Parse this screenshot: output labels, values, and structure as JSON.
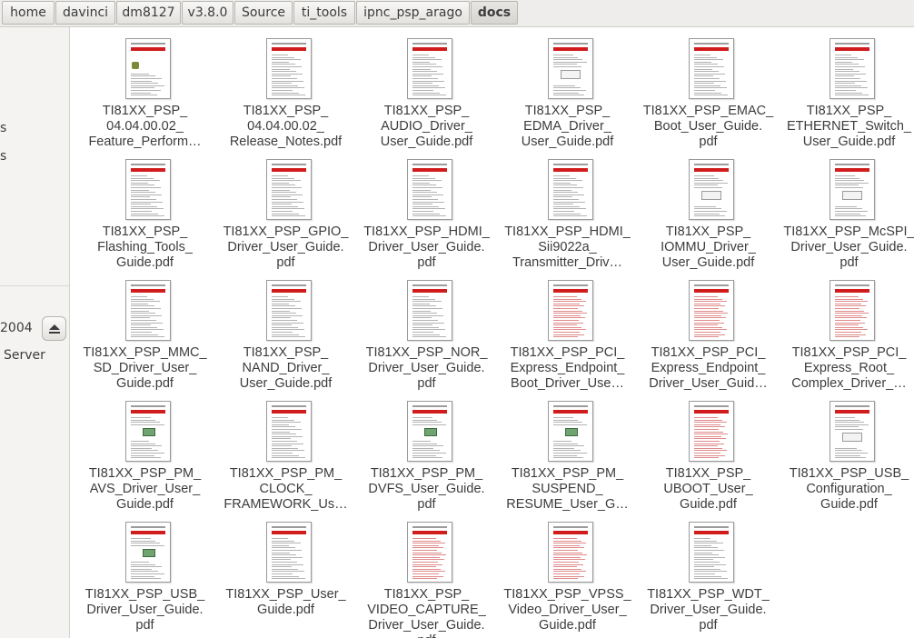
{
  "breadcrumb": [
    "home",
    "davinci",
    "dm8127",
    "v3.8.0",
    "Source",
    "ti_tools",
    "ipnc_psp_arago",
    "docs"
  ],
  "sidebar": {
    "items": [
      "s",
      "s",
      "2004",
      "Server"
    ]
  },
  "files": [
    {
      "lines": [
        "TI81XX_PSP_",
        "04.04.00.02_",
        "Feature_Perform…"
      ],
      "thumb": "logo"
    },
    {
      "lines": [
        "TI81XX_PSP_",
        "04.04.00.02_",
        "Release_Notes.pdf"
      ],
      "thumb": "text"
    },
    {
      "lines": [
        "TI81XX_PSP_",
        "AUDIO_Driver_",
        "User_Guide.pdf"
      ],
      "thumb": "text"
    },
    {
      "lines": [
        "TI81XX_PSP_",
        "EDMA_Driver_",
        "User_Guide.pdf"
      ],
      "thumb": "figure"
    },
    {
      "lines": [
        "TI81XX_PSP_EMAC_",
        "Boot_User_Guide.",
        "pdf"
      ],
      "thumb": "text"
    },
    {
      "lines": [
        "TI81XX_PSP_",
        "ETHERNET_Switch_",
        "User_Guide.pdf"
      ],
      "thumb": "text"
    },
    {
      "lines": [
        "TI81XX_PSP_",
        "Flashing_Tools_",
        "Guide.pdf"
      ],
      "thumb": "text"
    },
    {
      "lines": [
        "TI81XX_PSP_GPIO_",
        "Driver_User_Guide.",
        "pdf"
      ],
      "thumb": "text"
    },
    {
      "lines": [
        "TI81XX_PSP_HDMI_",
        "Driver_User_Guide.",
        "pdf"
      ],
      "thumb": "text"
    },
    {
      "lines": [
        "TI81XX_PSP_HDMI_",
        "Sii9022a_",
        "Transmitter_Driv…"
      ],
      "thumb": "text"
    },
    {
      "lines": [
        "TI81XX_PSP_",
        "IOMMU_Driver_",
        "User_Guide.pdf"
      ],
      "thumb": "figure"
    },
    {
      "lines": [
        "TI81XX_PSP_McSPI_",
        "Driver_User_Guide.",
        "pdf"
      ],
      "thumb": "figure"
    },
    {
      "lines": [
        "TI81XX_PSP_MMC_",
        "SD_Driver_User_",
        "Guide.pdf"
      ],
      "thumb": "text"
    },
    {
      "lines": [
        "TI81XX_PSP_",
        "NAND_Driver_",
        "User_Guide.pdf"
      ],
      "thumb": "text"
    },
    {
      "lines": [
        "TI81XX_PSP_NOR_",
        "Driver_User_Guide.",
        "pdf"
      ],
      "thumb": "text"
    },
    {
      "lines": [
        "TI81XX_PSP_PCI_",
        "Express_Endpoint_",
        "Boot_Driver_Use…"
      ],
      "thumb": "red"
    },
    {
      "lines": [
        "TI81XX_PSP_PCI_",
        "Express_Endpoint_",
        "Driver_User_Guid…"
      ],
      "thumb": "red"
    },
    {
      "lines": [
        "TI81XX_PSP_PCI_",
        "Express_Root_",
        "Complex_Driver_…"
      ],
      "thumb": "red"
    },
    {
      "lines": [
        "TI81XX_PSP_PM_",
        "AVS_Driver_User_",
        "Guide.pdf"
      ],
      "thumb": "table"
    },
    {
      "lines": [
        "TI81XX_PSP_PM_",
        "CLOCK_",
        "FRAMEWORK_Us…"
      ],
      "thumb": "text"
    },
    {
      "lines": [
        "TI81XX_PSP_PM_",
        "DVFS_User_Guide.",
        "pdf"
      ],
      "thumb": "table"
    },
    {
      "lines": [
        "TI81XX_PSP_PM_",
        "SUSPEND_",
        "RESUME_User_G…"
      ],
      "thumb": "table"
    },
    {
      "lines": [
        "TI81XX_PSP_",
        "UBOOT_User_",
        "Guide.pdf"
      ],
      "thumb": "red"
    },
    {
      "lines": [
        "TI81XX_PSP_USB_",
        "Configuration_",
        "Guide.pdf"
      ],
      "thumb": "figure"
    },
    {
      "lines": [
        "TI81XX_PSP_USB_",
        "Driver_User_Guide.",
        "pdf"
      ],
      "thumb": "table"
    },
    {
      "lines": [
        "TI81XX_PSP_User_",
        "Guide.pdf"
      ],
      "thumb": "text"
    },
    {
      "lines": [
        "TI81XX_PSP_",
        "VIDEO_CAPTURE_",
        "Driver_User_Guide.",
        "pdf"
      ],
      "thumb": "red"
    },
    {
      "lines": [
        "TI81XX_PSP_VPSS_",
        "Video_Driver_User_",
        "Guide.pdf"
      ],
      "thumb": "red"
    },
    {
      "lines": [
        "TI81XX_PSP_WDT_",
        "Driver_User_Guide.",
        "pdf"
      ],
      "thumb": "text"
    }
  ]
}
